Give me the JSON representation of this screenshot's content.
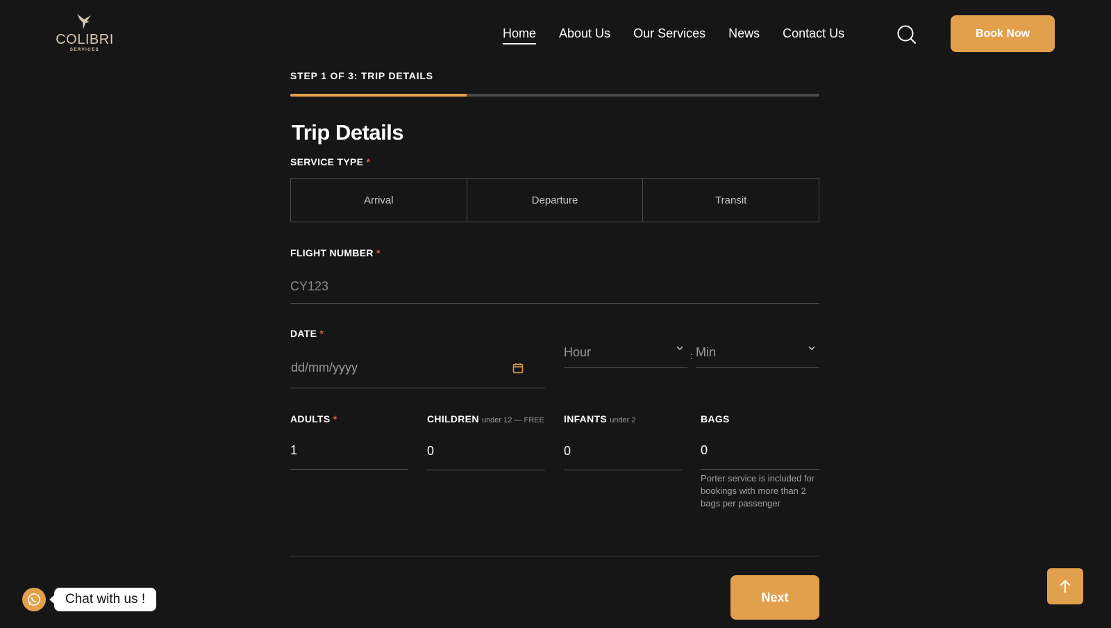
{
  "brand": {
    "name": "COLIBRI",
    "tagline": "SERVICES"
  },
  "nav": {
    "items": [
      {
        "label": "Home",
        "active": true
      },
      {
        "label": "About Us"
      },
      {
        "label": "Our Services"
      },
      {
        "label": "News"
      },
      {
        "label": "Contact Us"
      }
    ],
    "book_label": "Book Now"
  },
  "form": {
    "step_label": "STEP 1 OF 3: TRIP DETAILS",
    "progress": 0.3333,
    "title": "Trip Details",
    "service_type": {
      "label": "SERVICE TYPE",
      "options": [
        "Arrival",
        "Departure",
        "Transit"
      ]
    },
    "flight_number": {
      "label": "FLIGHT NUMBER",
      "placeholder": "CY123"
    },
    "date": {
      "label": "DATE",
      "placeholder": "dd/mm/yyyy",
      "hour": "Hour",
      "separator": ":",
      "min": "Min"
    },
    "adults": {
      "label": "ADULTS",
      "value": "1"
    },
    "children": {
      "label": "CHILDREN",
      "hint": "under 12 — FREE",
      "value": "0"
    },
    "infants": {
      "label": "INFANTS",
      "hint": "under 2",
      "value": "0"
    },
    "bags": {
      "label": "BAGS",
      "value": "0",
      "note": "Porter service is included for bookings with more than 2 bags per passenger"
    },
    "required_mark": "*",
    "next_label": "Next"
  },
  "chat": {
    "label": "Chat with us !"
  },
  "colors": {
    "accent": "#e3a04c",
    "background": "#161616",
    "required": "#e05a4a"
  },
  "icons": {
    "search": "search-icon",
    "calendar": "calendar-icon",
    "chat": "whatsapp-icon",
    "scroll_top": "arrow-up-icon"
  }
}
